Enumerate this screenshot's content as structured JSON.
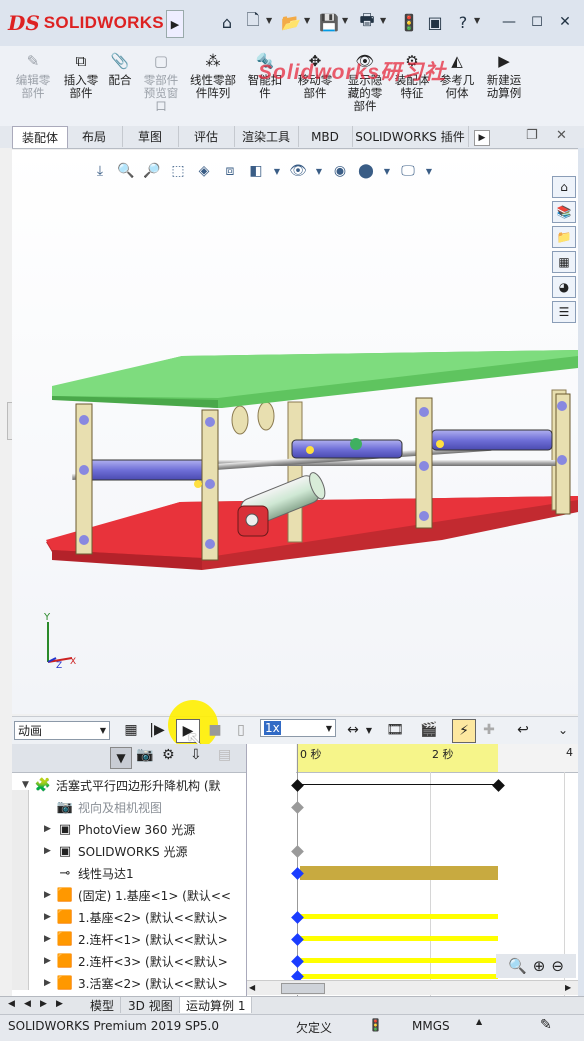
{
  "app": {
    "brand": "SOLIDWORKS",
    "brand_prefix": "DS"
  },
  "watermark": "Solidworks研习社",
  "command_manager": [
    {
      "label_lines": [
        "编辑零",
        "部件"
      ],
      "disabled": true,
      "icon": "edit-component-icon"
    },
    {
      "label_lines": [
        "插入零",
        "部件"
      ],
      "disabled": false,
      "icon": "insert-component-icon"
    },
    {
      "label_lines": [
        "配合"
      ],
      "disabled": false,
      "icon": "mate-icon"
    },
    {
      "label_lines": [
        "零部件",
        "预览窗",
        "口"
      ],
      "disabled": true,
      "icon": "preview-window-icon"
    },
    {
      "label_lines": [
        "线性零部",
        "件阵列"
      ],
      "disabled": false,
      "icon": "linear-pattern-icon"
    },
    {
      "label_lines": [
        "智能扣",
        "件"
      ],
      "disabled": false,
      "icon": "smart-fasteners-icon"
    },
    {
      "label_lines": [
        "移动零",
        "部件"
      ],
      "disabled": false,
      "icon": "move-component-icon"
    },
    {
      "label_lines": [
        "显示隐",
        "藏的零",
        "部件"
      ],
      "disabled": false,
      "icon": "show-hidden-icon"
    },
    {
      "label_lines": [
        "装配体",
        "特征"
      ],
      "disabled": false,
      "icon": "assembly-features-icon"
    },
    {
      "label_lines": [
        "参考几",
        "何体"
      ],
      "disabled": false,
      "icon": "reference-geometry-icon"
    },
    {
      "label_lines": [
        "新建运",
        "动算例"
      ],
      "disabled": false,
      "icon": "new-motion-study-icon"
    }
  ],
  "tabs": [
    "装配体",
    "布局",
    "草图",
    "评估",
    "渲染工具",
    "MBD",
    "SOLIDWORKS 插件"
  ],
  "active_tab": "装配体",
  "motion_toolbar": {
    "study_type": "动画",
    "playback_speed": "1x"
  },
  "timeline": {
    "tick_0": "0 秒",
    "tick_2": "2 秒",
    "tick_4": "4"
  },
  "tree": [
    {
      "label": "活塞式平行四边形升降机构 (默",
      "icon": "assembly-icon",
      "expander": "▼"
    },
    {
      "label": "视向及相机视图",
      "icon": "camera-icon",
      "expander": "",
      "dim": true
    },
    {
      "label": "PhotoView 360 光源",
      "icon": "photoview-icon",
      "expander": "▶"
    },
    {
      "label": "SOLIDWORKS 光源",
      "icon": "lights-icon",
      "expander": "▶"
    },
    {
      "label": "线性马达1",
      "icon": "linear-motor-icon",
      "expander": ""
    },
    {
      "label": "(固定) 1.基座<1> (默认<<",
      "icon": "part-icon",
      "expander": "▶"
    },
    {
      "label": "1.基座<2> (默认<<默认>",
      "icon": "part-icon",
      "expander": "▶"
    },
    {
      "label": "2.连杆<1> (默认<<默认>",
      "icon": "part-icon",
      "expander": "▶"
    },
    {
      "label": "2.连杆<3> (默认<<默认>",
      "icon": "part-icon",
      "expander": "▶"
    },
    {
      "label": "3.活塞<2> (默认<<默认>",
      "icon": "part-icon",
      "expander": "▶"
    }
  ],
  "bottom_tabs": [
    "模型",
    "3D 视图",
    "运动算例 1"
  ],
  "active_bottom_tab": "运动算例 1",
  "status": {
    "product": "SOLIDWORKS Premium 2019 SP5.0",
    "state": "欠定义",
    "units": "MMGS"
  },
  "colors": {
    "top_plate": "#7edc7e",
    "base_plate": "#e8333b",
    "links": "#e8dfb0",
    "cylinders": "#8888e0",
    "timeline_yellow": "#ffff00",
    "timeline_olive": "#c8aa40",
    "key_blue": "#1a3cff"
  }
}
